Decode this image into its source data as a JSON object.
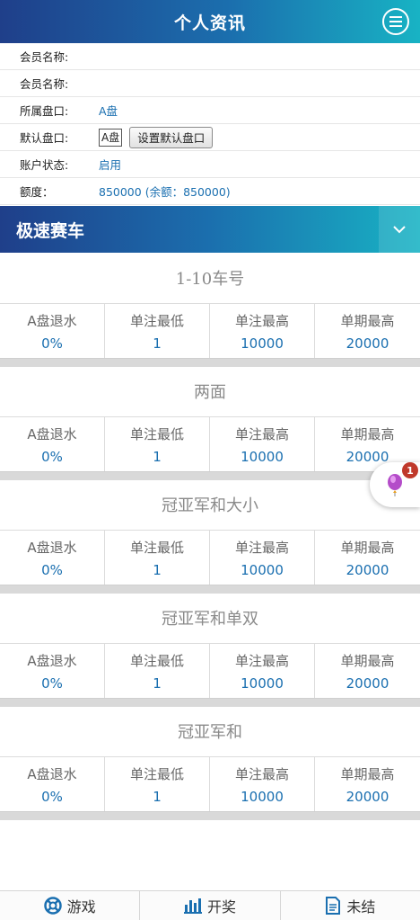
{
  "header": {
    "title": "个人资讯"
  },
  "info": [
    {
      "label": "会员名称:",
      "value": ""
    },
    {
      "label": "会员名称:",
      "value": ""
    },
    {
      "label": "所属盘口:",
      "value": "A盘"
    },
    {
      "label": "默认盘口:",
      "select": "A盘",
      "button": "设置默认盘口"
    },
    {
      "label": "账户状态:",
      "value": "启用"
    },
    {
      "label": "额度：",
      "value": "850000 (余额：850000)"
    }
  ],
  "section": {
    "title": "极速赛车"
  },
  "table_headers": [
    "A盘退水",
    "单注最低",
    "单注最高",
    "单期最高"
  ],
  "blocks": [
    {
      "title": "1-10车号",
      "values": [
        "0%",
        "1",
        "10000",
        "20000"
      ]
    },
    {
      "title": "两面",
      "values": [
        "0%",
        "1",
        "10000",
        "20000"
      ]
    },
    {
      "title": "冠亚军和大小",
      "values": [
        "0%",
        "1",
        "10000",
        "20000"
      ]
    },
    {
      "title": "冠亚军和单双",
      "values": [
        "0%",
        "1",
        "10000",
        "20000"
      ]
    },
    {
      "title": "冠亚军和",
      "values": [
        "0%",
        "1",
        "10000",
        "20000"
      ]
    }
  ],
  "float": {
    "badge": "1"
  },
  "footer": {
    "tabs": [
      {
        "label": "游戏",
        "icon": "lifebuoy-icon"
      },
      {
        "label": "开奖",
        "icon": "bar-chart-icon"
      },
      {
        "label": "未结",
        "icon": "document-icon"
      }
    ]
  }
}
